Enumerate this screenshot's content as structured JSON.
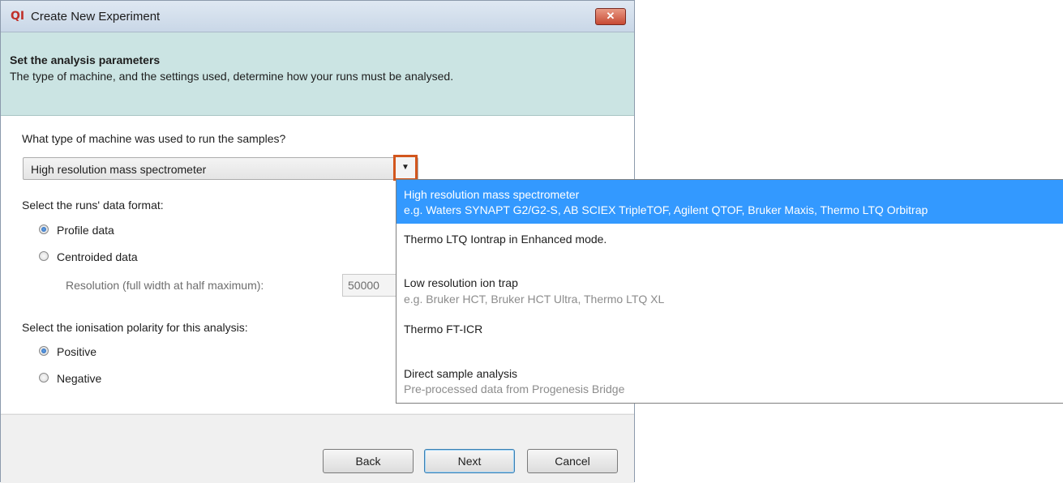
{
  "window": {
    "app_icon": "QI",
    "title": "Create New Experiment",
    "close_glyph": "✕"
  },
  "header": {
    "title": "Set the analysis parameters",
    "description": "The type of machine, and the settings used, determine how your runs must be analysed."
  },
  "form": {
    "machine_question": "What type of machine was used to run the samples?",
    "machine_selected": "High resolution mass spectrometer",
    "dropdown_arrow": "▼",
    "data_format_label": "Select the runs' data format:",
    "data_format_options": [
      {
        "label": "Profile data",
        "checked": true
      },
      {
        "label": "Centroided data",
        "checked": false
      }
    ],
    "resolution_label": "Resolution (full width at half maximum):",
    "resolution_value": "50000",
    "polarity_label": "Select the ionisation polarity for this analysis:",
    "polarity_options": [
      {
        "label": "Positive",
        "checked": true
      },
      {
        "label": "Negative",
        "checked": false
      }
    ]
  },
  "buttons": {
    "back": "Back",
    "next": "Next",
    "cancel": "Cancel"
  },
  "dropdown": {
    "items": [
      {
        "label": "High resolution mass spectrometer",
        "subtitle": "e.g. Waters SYNAPT G2/G2-S, AB SCIEX TripleTOF, Agilent QTOF, Bruker Maxis, Thermo LTQ Orbitrap",
        "selected": true
      },
      {
        "label": "Thermo LTQ Iontrap in Enhanced mode.",
        "subtitle": "",
        "selected": false
      },
      {
        "label": "Low resolution ion trap",
        "subtitle": "e.g. Bruker HCT, Bruker HCT Ultra, Thermo LTQ XL",
        "selected": false
      },
      {
        "label": "Thermo FT-ICR",
        "subtitle": "",
        "selected": false
      },
      {
        "label": "Direct sample analysis",
        "subtitle": "Pre-processed data from Progenesis Bridge",
        "selected": false
      }
    ]
  },
  "colors": {
    "header_band": "#cbe4e3",
    "selection": "#3399ff",
    "highlight_border": "#d2561d"
  }
}
